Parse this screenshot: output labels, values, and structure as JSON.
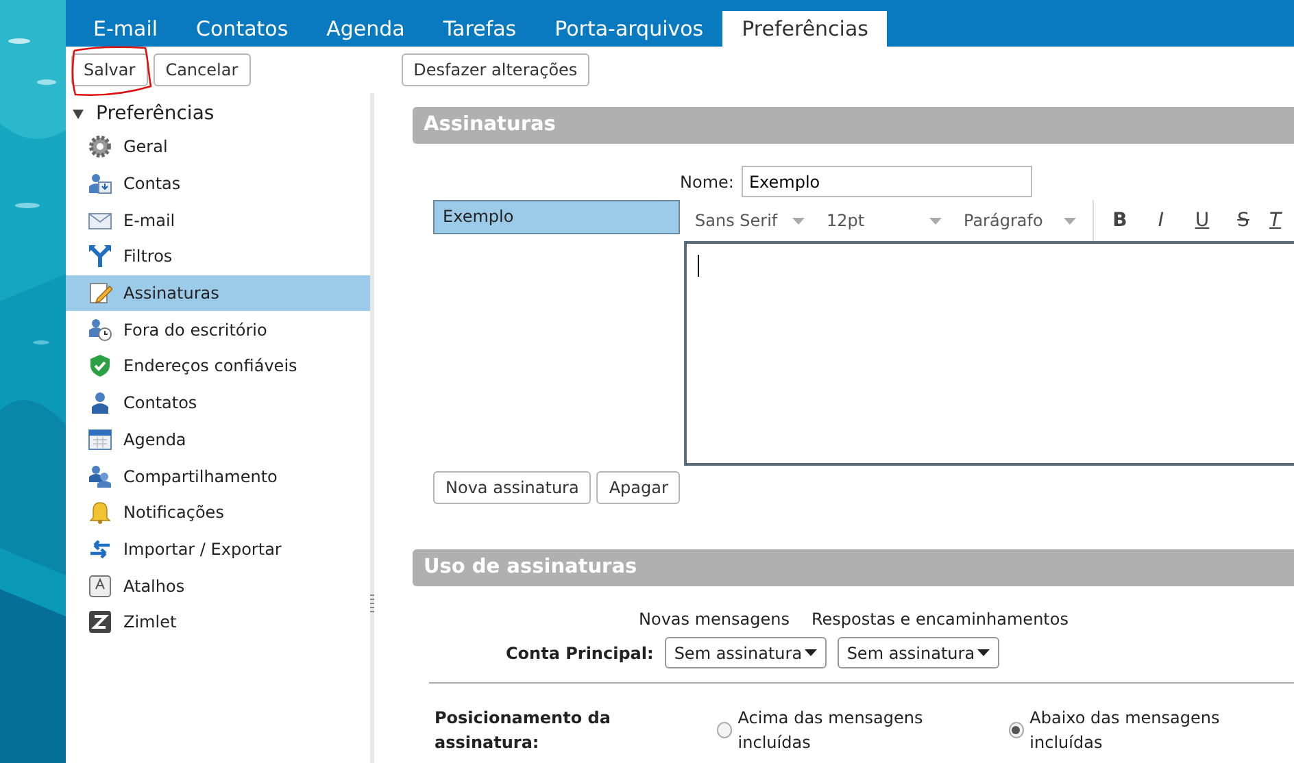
{
  "tabs": [
    {
      "label": "E-mail",
      "selected": false
    },
    {
      "label": "Contatos",
      "selected": false
    },
    {
      "label": "Agenda",
      "selected": false
    },
    {
      "label": "Tarefas",
      "selected": false
    },
    {
      "label": "Porta-arquivos",
      "selected": false
    },
    {
      "label": "Preferências",
      "selected": true
    }
  ],
  "toolbar": {
    "buttons": [
      "Salvar",
      "Cancelar"
    ],
    "undo": "Desfazer alterações"
  },
  "sidebar": {
    "title": "Preferências",
    "expanded": true,
    "items": [
      {
        "label": "Geral",
        "selected": false
      },
      {
        "label": "Contas",
        "selected": false
      },
      {
        "label": "E-mail",
        "selected": false
      },
      {
        "label": "Filtros",
        "selected": false
      },
      {
        "label": "Assinaturas",
        "selected": true
      },
      {
        "label": "Fora do escritório",
        "selected": false
      },
      {
        "label": "Endereços confiáveis",
        "selected": false
      },
      {
        "label": "Contatos",
        "selected": false
      },
      {
        "label": "Agenda",
        "selected": false
      },
      {
        "label": "Compartilhamento",
        "selected": false
      },
      {
        "label": "Notificações",
        "selected": false
      },
      {
        "label": "Importar / Exportar",
        "selected": false
      },
      {
        "label": "Atalhos",
        "selected": false
      },
      {
        "label": "Zimlet",
        "selected": false
      }
    ]
  },
  "signatures": {
    "title": "Assinaturas",
    "name_label": "Nome:",
    "name_value": "Exemplo",
    "list": [
      {
        "label": "Exemplo",
        "selected": true
      }
    ],
    "editor": {
      "font": "Sans Serif",
      "size": "12pt",
      "format": "Parágrafo",
      "format_buttons": [
        "B",
        "I",
        "U",
        "S",
        "T"
      ]
    },
    "buttons": [
      "Nova assinatura",
      "Apagar"
    ]
  },
  "usage": {
    "title": "Uso de assinaturas",
    "column_labels": [
      "Novas mensagens",
      "Respostas e encaminhamentos"
    ],
    "account_label": "Conta Principal:",
    "selects": [
      "Sem assinatura",
      "Sem assinatura"
    ],
    "placement_label": "Posicionamento da assinatura:",
    "placement_options": [
      {
        "label": "Acima das mensagens incluídas",
        "selected": false
      },
      {
        "label": "Abaixo das mensagens incluídas",
        "selected": true
      }
    ]
  }
}
